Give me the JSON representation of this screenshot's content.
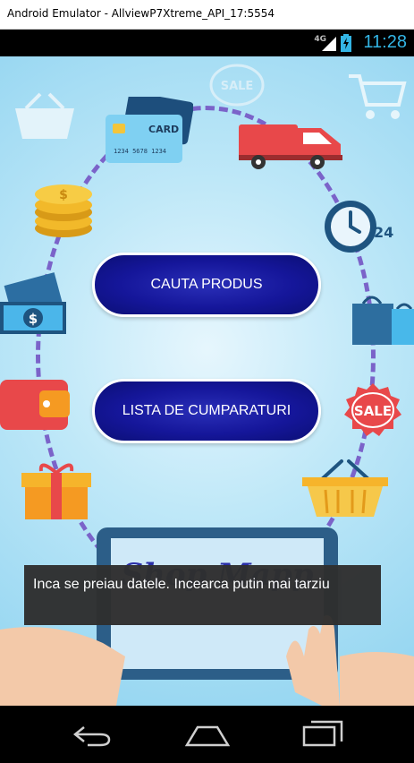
{
  "window": {
    "title": "Android Emulator - AllviewP7Xtreme_API_17:5554"
  },
  "statusbar": {
    "network": "4G",
    "time": "11:28",
    "accent": "#33b5e5"
  },
  "app": {
    "buttons": [
      {
        "label": "CAUTA PRODUS"
      },
      {
        "label": "LISTA DE CUMPARATURI"
      }
    ],
    "decor": {
      "card_text": "CARD",
      "card_number": "1234 5678 1234",
      "sale_text": "SALE",
      "clock_badge": "24",
      "logo_text": "Shop Mapp"
    }
  },
  "toast": {
    "message": "Inca se preiau datele. Incearca putin mai tarziu"
  },
  "navbar": {
    "icons": [
      "back-icon",
      "home-icon",
      "recents-icon"
    ]
  }
}
